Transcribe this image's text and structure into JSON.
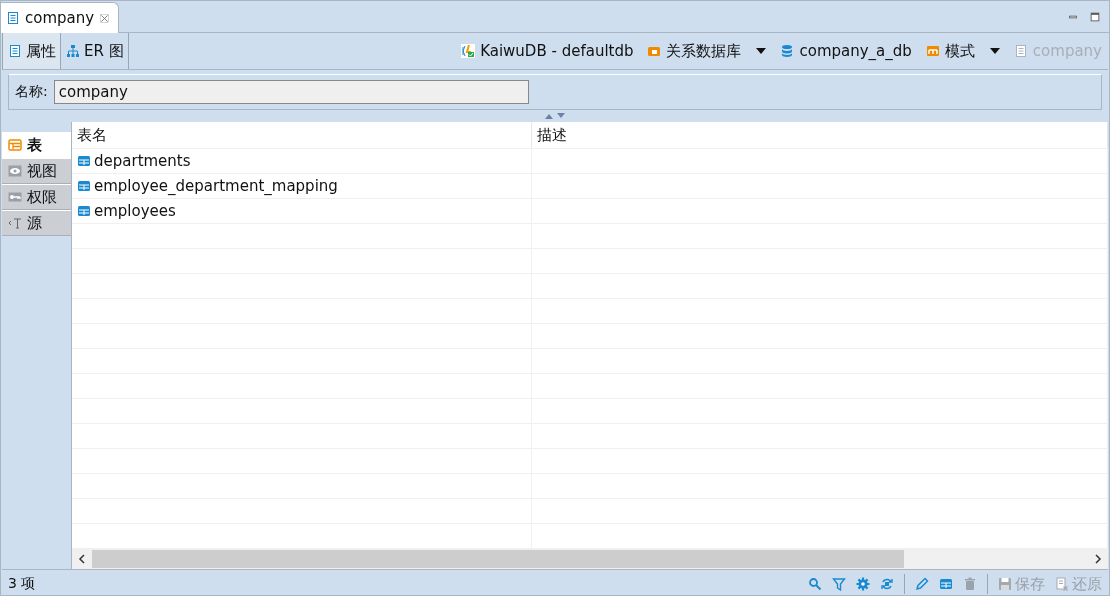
{
  "editor_tab": {
    "title": "company",
    "selected": true
  },
  "view_tabs": [
    {
      "label": "属性",
      "kind": "properties",
      "selected": true
    },
    {
      "label": "ER 图",
      "kind": "diagram",
      "selected": false
    }
  ],
  "breadcrumb": [
    {
      "label": "KaiwuDB - defaultdb",
      "kind": "connection",
      "dropdown": false,
      "disabled": false
    },
    {
      "label": "关系数据库",
      "kind": "folder",
      "dropdown": true,
      "disabled": false
    },
    {
      "label": "company_a_db",
      "kind": "database",
      "dropdown": false,
      "disabled": false
    },
    {
      "label": "模式",
      "kind": "schema",
      "dropdown": true,
      "disabled": false
    },
    {
      "label": "company",
      "kind": "page",
      "dropdown": false,
      "disabled": true
    }
  ],
  "name_field": {
    "label": "名称:",
    "value": "company"
  },
  "side_tabs": [
    {
      "label": "表",
      "kind": "table",
      "selected": true
    },
    {
      "label": "视图",
      "kind": "view",
      "selected": false
    },
    {
      "label": "权限",
      "kind": "key",
      "selected": false
    },
    {
      "label": "源",
      "kind": "source",
      "selected": false
    }
  ],
  "table": {
    "columns": [
      "表名",
      "描述"
    ],
    "rows": [
      {
        "name": "departments"
      },
      {
        "name": "employee_department_mapping"
      },
      {
        "name": "employees"
      }
    ]
  },
  "status_bar": {
    "count": "3 项",
    "tools": [
      {
        "kind": "search"
      },
      {
        "kind": "filter"
      },
      {
        "kind": "settings"
      },
      {
        "kind": "refresh"
      },
      {
        "kind": "edit"
      },
      {
        "kind": "grid"
      },
      {
        "kind": "delete"
      }
    ],
    "actions": [
      {
        "label": "保存",
        "kind": "save",
        "disabled": true
      },
      {
        "label": "还原",
        "kind": "revert",
        "disabled": true
      }
    ]
  }
}
